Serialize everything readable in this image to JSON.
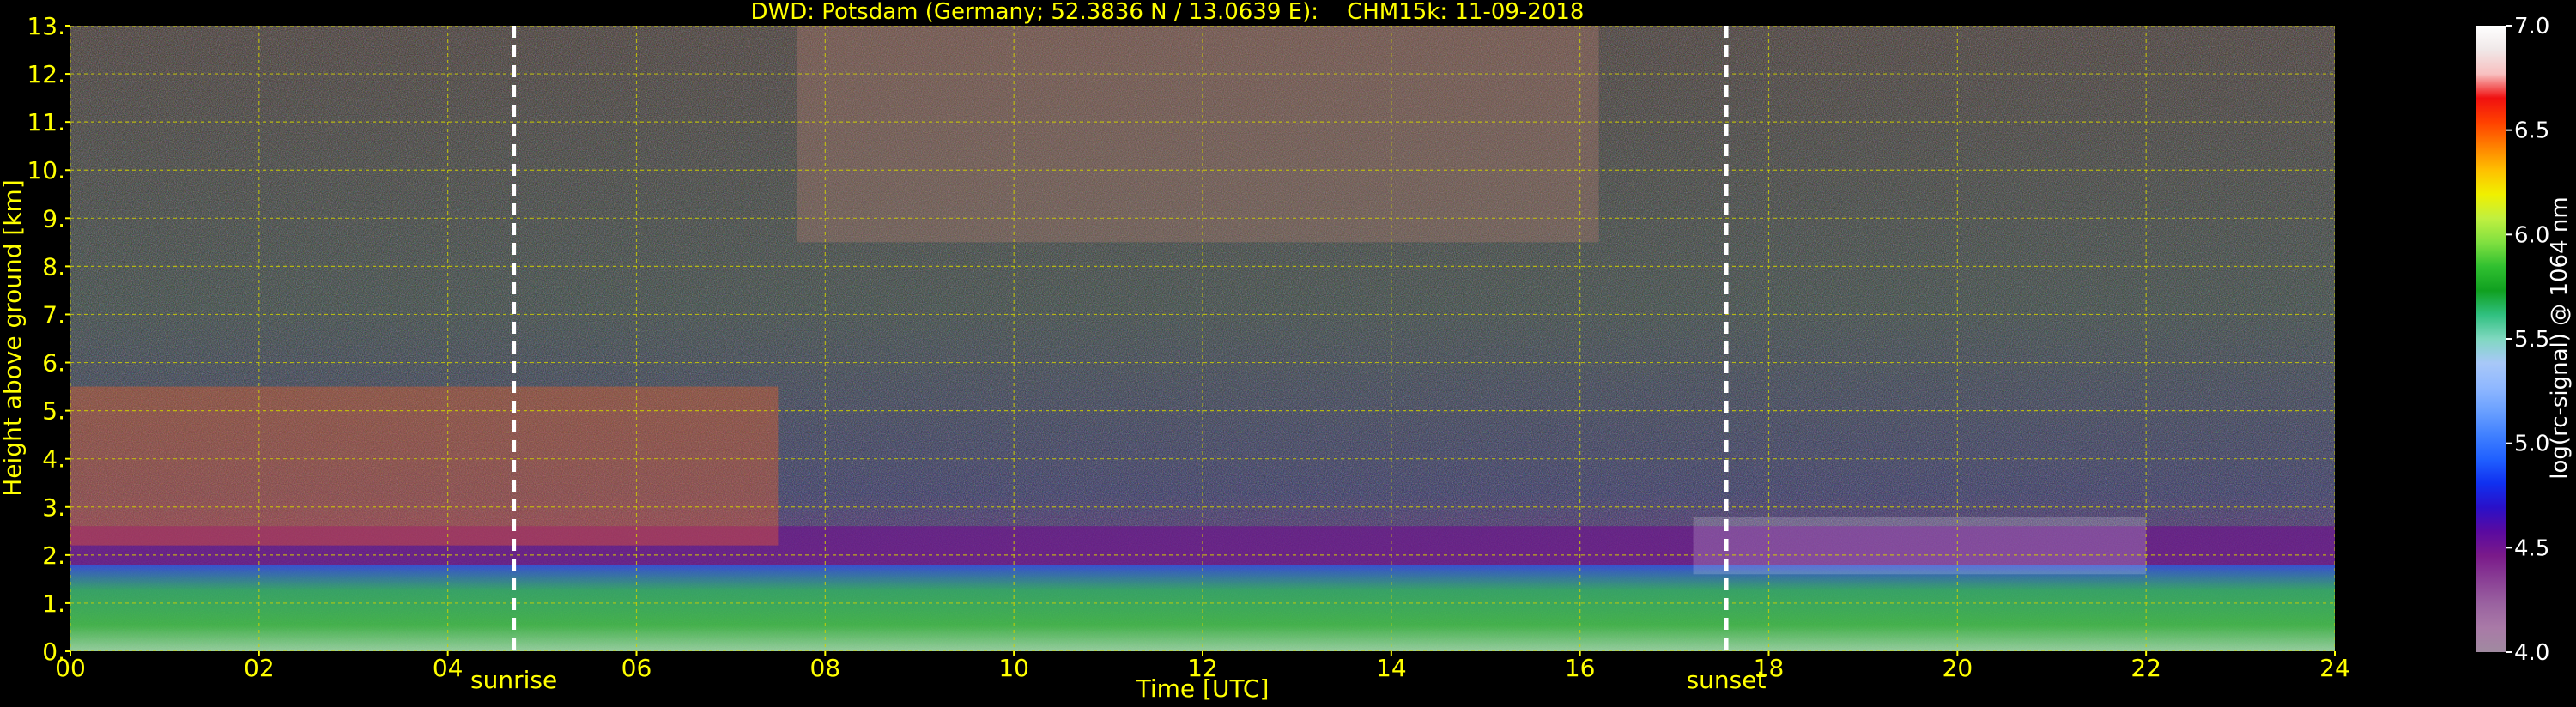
{
  "chart_data": {
    "type": "heatmap",
    "title": "DWD: Potsdam (Germany; 52.3836 N / 13.0639 E):    CHM15k: 11-09-2018",
    "xlabel": "Time [UTC]",
    "ylabel": "Height above ground [km]",
    "xlim": [
      0,
      24
    ],
    "ylim": [
      0,
      13
    ],
    "x_ticks": [
      "00",
      "02",
      "04",
      "06",
      "08",
      "10",
      "12",
      "14",
      "16",
      "18",
      "20",
      "22",
      "24"
    ],
    "y_ticks": [
      "0.",
      "1.",
      "2.",
      "3.",
      "4.",
      "5.",
      "6.",
      "7.",
      "8.",
      "9.",
      "10.",
      "11.",
      "12.",
      "13."
    ],
    "grid": true,
    "markers": [
      {
        "label": "sunrise",
        "time": 4.7
      },
      {
        "label": "sunset",
        "time": 17.55
      }
    ],
    "colorbar": {
      "label": "log(rc-signal) @ 1064 nm",
      "range": [
        4.0,
        7.0
      ],
      "ticks": [
        "4.0",
        "4.5",
        "5.0",
        "5.5",
        "6.0",
        "6.5",
        "7.0"
      ],
      "colors": [
        "#a08aa0",
        "#a97aa7",
        "#9a62a0",
        "#8a3f95",
        "#7a1a8a",
        "#5a0aa0",
        "#2a10c8",
        "#1030f0",
        "#2060ff",
        "#4080ff",
        "#6aa0ff",
        "#90b8ff",
        "#a8c8f8",
        "#80d8c0",
        "#30c080",
        "#10a020",
        "#30c030",
        "#80e040",
        "#c0f040",
        "#f0f000",
        "#ffc000",
        "#ff8000",
        "#ff4000",
        "#f01010",
        "#f8c0c0",
        "#f0e8e8",
        "#ffffff"
      ]
    },
    "features": {
      "boundary_layer": {
        "time": [
          0,
          24
        ],
        "height_km": [
          0,
          1.8
        ]
      },
      "residual_layer": {
        "time": [
          0,
          24
        ],
        "height_km": [
          1.8,
          2.6
        ]
      },
      "low_cloud_morning": {
        "time": [
          0,
          7.5
        ],
        "height_km": [
          2.2,
          5.5
        ]
      },
      "cirrus": {
        "time": [
          7.7,
          16.2
        ],
        "height_km": [
          8.5,
          13
        ]
      },
      "cloud_patch_evening": {
        "time": [
          17.2,
          22.0
        ],
        "height_km": [
          1.6,
          2.8
        ]
      }
    }
  }
}
